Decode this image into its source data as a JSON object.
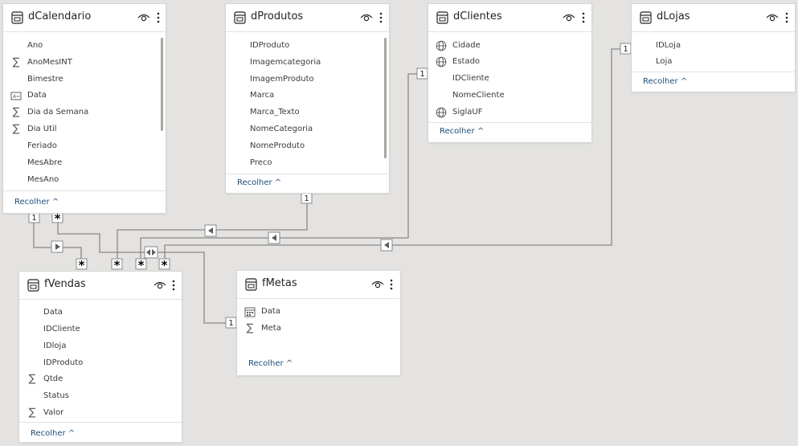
{
  "tables": {
    "dCalendario": {
      "name": "dCalendario",
      "fields": [
        {
          "name": "Ano",
          "icon": ""
        },
        {
          "name": "AnoMesINT",
          "icon": "sigma"
        },
        {
          "name": "Bimestre",
          "icon": ""
        },
        {
          "name": "Data",
          "icon": "calendar-text"
        },
        {
          "name": "Dia da Semana",
          "icon": "sigma"
        },
        {
          "name": "Dia Util",
          "icon": "sigma"
        },
        {
          "name": "Feriado",
          "icon": ""
        },
        {
          "name": "MesAbre",
          "icon": ""
        },
        {
          "name": "MesAno",
          "icon": ""
        }
      ],
      "collapse_label": "Recolher"
    },
    "dProdutos": {
      "name": "dProdutos",
      "fields": [
        {
          "name": "IDProduto",
          "icon": ""
        },
        {
          "name": "Imagemcategoria",
          "icon": ""
        },
        {
          "name": "ImagemProduto",
          "icon": ""
        },
        {
          "name": "Marca",
          "icon": ""
        },
        {
          "name": "Marca_Texto",
          "icon": ""
        },
        {
          "name": "NomeCategoria",
          "icon": ""
        },
        {
          "name": "NomeProduto",
          "icon": ""
        },
        {
          "name": "Preco",
          "icon": ""
        }
      ],
      "collapse_label": "Recolher"
    },
    "dClientes": {
      "name": "dClientes",
      "fields": [
        {
          "name": "Cidade",
          "icon": "globe"
        },
        {
          "name": "Estado",
          "icon": "globe"
        },
        {
          "name": "IDCliente",
          "icon": ""
        },
        {
          "name": "NomeCliente",
          "icon": ""
        },
        {
          "name": "SiglaUF",
          "icon": "globe"
        }
      ],
      "collapse_label": "Recolher"
    },
    "dLojas": {
      "name": "dLojas",
      "fields": [
        {
          "name": "IDLoja",
          "icon": ""
        },
        {
          "name": "Loja",
          "icon": ""
        }
      ],
      "collapse_label": "Recolher"
    },
    "fVendas": {
      "name": "fVendas",
      "fields": [
        {
          "name": "Data",
          "icon": ""
        },
        {
          "name": "IDCliente",
          "icon": ""
        },
        {
          "name": "IDloja",
          "icon": ""
        },
        {
          "name": "IDProduto",
          "icon": ""
        },
        {
          "name": "Qtde",
          "icon": "sigma"
        },
        {
          "name": "Status",
          "icon": ""
        },
        {
          "name": "Valor",
          "icon": "sigma"
        }
      ],
      "collapse_label": "Recolher"
    },
    "fMetas": {
      "name": "fMetas",
      "fields": [
        {
          "name": "Data",
          "icon": "calendar"
        },
        {
          "name": "Meta",
          "icon": "sigma"
        }
      ],
      "collapse_label": "Recolher"
    }
  },
  "relationships": {
    "one": "1",
    "many": "*"
  },
  "colors": {
    "line": "#8a8886",
    "link": "#1e4e79",
    "background": "#e4e3e1"
  }
}
